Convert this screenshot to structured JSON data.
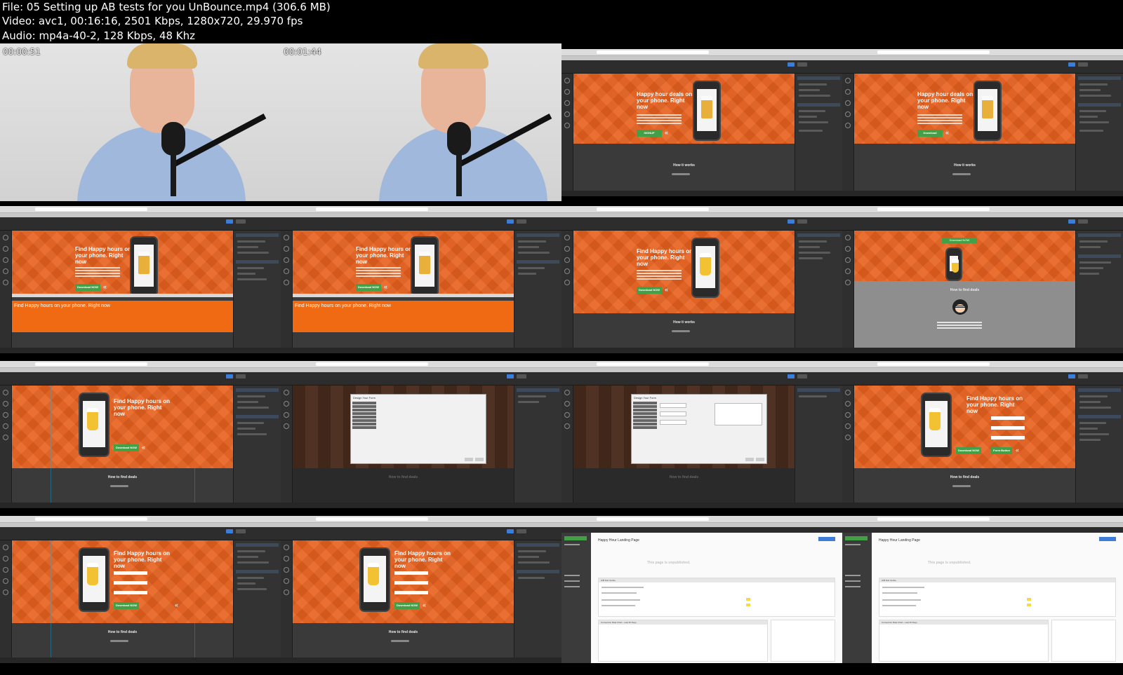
{
  "header": {
    "file_line": "File: 05 Setting up AB tests for you UnBounce.mp4 (306.6 MB)",
    "video_line": "Video: avc1, 00:16:16, 2501 Kbps, 1280x720, 29.970 fps",
    "audio_line": "Audio: mp4a-40-2, 128 Kbps, 48 Khz"
  },
  "thumbnails": [
    {
      "timestamp": "00:00:51"
    },
    {
      "timestamp": "00:01:44"
    },
    {
      "hero_title": "Happy hour deals on your phone. Right now",
      "button": "SIGNUP",
      "section": "How it works"
    },
    {
      "hero_title": "Happy hour deals on your phone. Right now",
      "button": "Download",
      "section": "How it works"
    },
    {
      "hero_title": "Find Happy hours on your phone. Right now",
      "button": "Download NOW",
      "strip_text": "Find Happy hours on your phone. Right now"
    },
    {
      "hero_title": "Find Happy hours on your phone. Right now",
      "button": "Download NOW",
      "strip_text": "Find Happy hours on your phone. Right now"
    },
    {
      "hero_title": "Find Happy hours on your phone. Right now",
      "button": "Download NOW",
      "section": "How it works"
    },
    {
      "top_button": "Download NOW",
      "section": "How to find deals"
    },
    {
      "hero_title": "Find Happy hours on your phone. Right now",
      "button": "Download NOW",
      "section": "How to find deals"
    },
    {
      "modal_title": "Design Your Form",
      "section": "How to find deals"
    },
    {
      "modal_title": "Design Your Form",
      "section": "How to find deals"
    },
    {
      "hero_title": "Find Happy hours on your phone. Right now",
      "button": "Download NOW",
      "button2": "Form Button",
      "section": "How to find deals"
    },
    {
      "hero_title": "Find Happy hours on your phone. Right now",
      "button": "Download NOW",
      "section": "How to find deals"
    },
    {
      "hero_title": "Find Happy hours on your phone. Right now",
      "button": "Download NOW",
      "section": "How to find deals"
    },
    {
      "page_title": "Happy Hour Landing Page",
      "unpublished": "This page is unpublished.",
      "panel1": "A/B Test Centre",
      "panel2": "Conversion Rate Chart - Last 30 Days"
    },
    {
      "page_title": "Happy Hour Landing Page",
      "unpublished": "This page is unpublished.",
      "panel1": "A/B Test Centre",
      "panel2": "Conversion Rate Chart - Last 30 Days"
    }
  ]
}
